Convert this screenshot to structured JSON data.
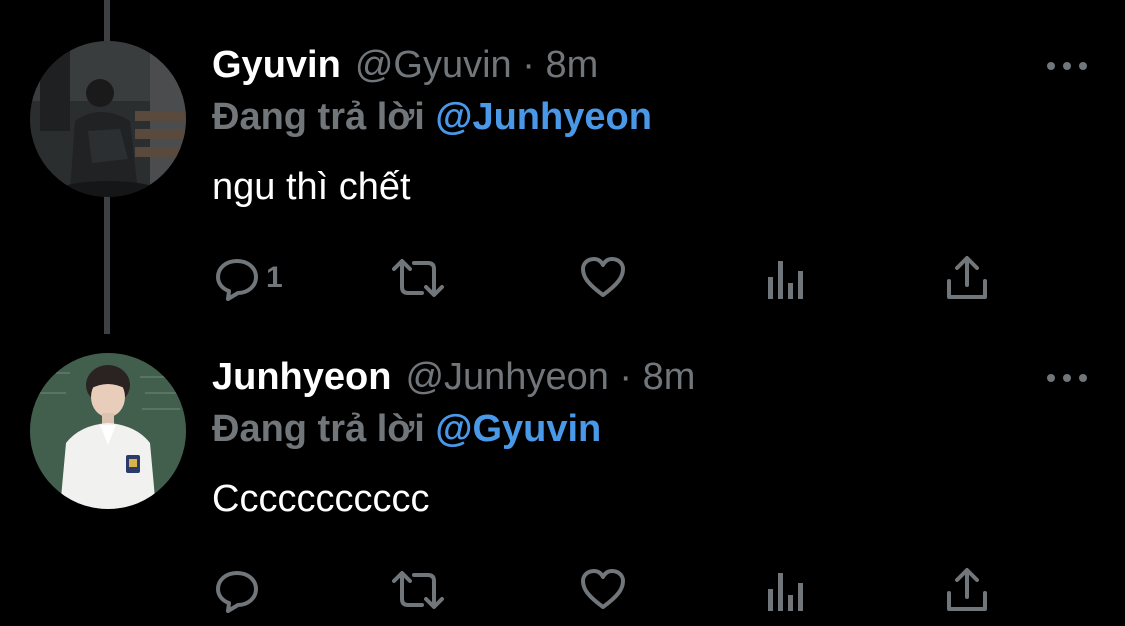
{
  "tweets": [
    {
      "name": "Gyuvin",
      "handle": "@Gyuvin",
      "time": "8m",
      "reply_prefix": "Đang trả lời",
      "reply_to": "@Junhyeon",
      "text": "ngu thì chết",
      "reply_count": "1",
      "avatar_icon": "avatar-photo-gyuvin"
    },
    {
      "name": "Junhyeon",
      "handle": "@Junhyeon",
      "time": "8m",
      "reply_prefix": "Đang trả lời",
      "reply_to": "@Gyuvin",
      "text": "Ccccccccccc",
      "reply_count": "",
      "avatar_icon": "avatar-photo-junhyeon"
    }
  ],
  "separator": "·",
  "icons": [
    "reply-icon",
    "retweet-icon",
    "like-icon",
    "views-icon",
    "share-icon",
    "more-icon"
  ],
  "colors": {
    "background": "#000000",
    "secondary_text": "#71767b",
    "mention": "#4a99e9",
    "thread_line": "#3e4144"
  }
}
